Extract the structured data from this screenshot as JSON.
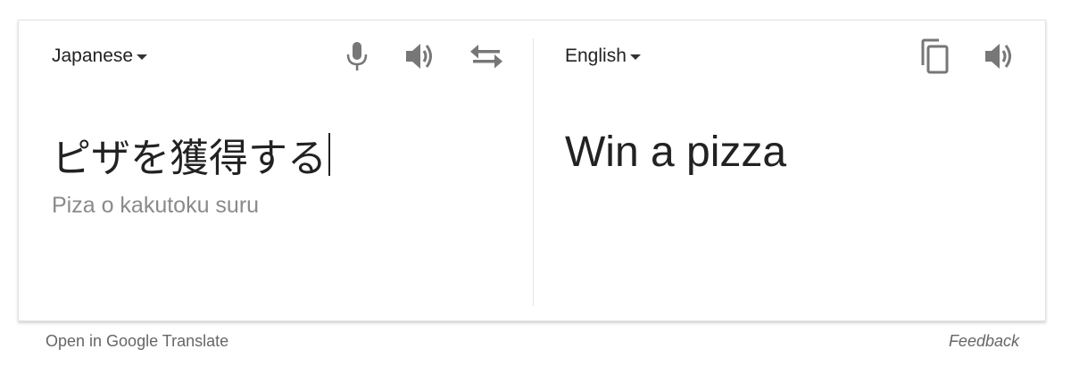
{
  "source": {
    "language": "Japanese",
    "text": "ピザを獲得する",
    "romanization": "Piza o kakutoku suru"
  },
  "target": {
    "language": "English",
    "text": "Win a pizza"
  },
  "icons": {
    "microphone": "microphone-icon",
    "listen_source": "speaker-icon",
    "swap": "swap-arrows-icon",
    "copy": "copy-icon",
    "listen_target": "speaker-icon"
  },
  "footer": {
    "open_link": "Open in Google Translate",
    "feedback": "Feedback"
  },
  "colors": {
    "text": "#222222",
    "icon": "#777777",
    "muted": "#8a8a8a",
    "footer": "#666666"
  }
}
